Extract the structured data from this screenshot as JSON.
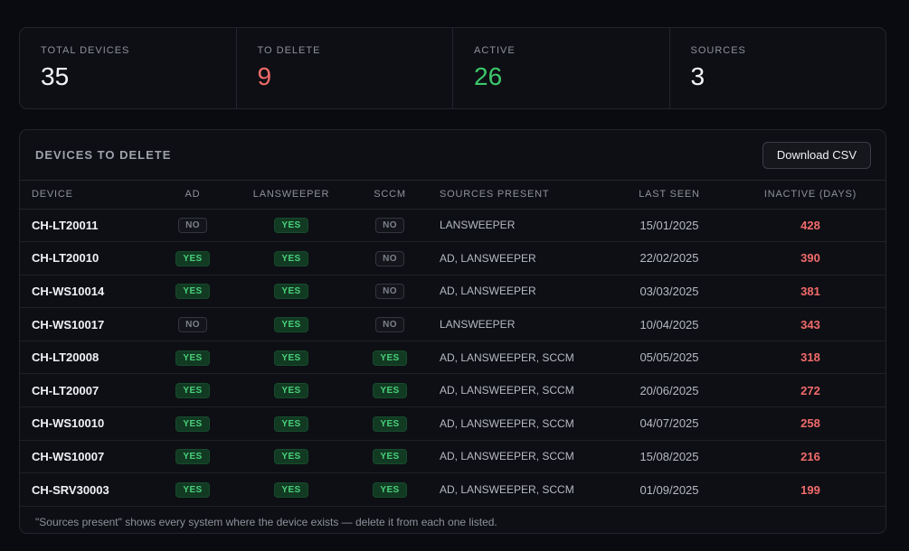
{
  "stats": [
    {
      "label": "TOTAL DEVICES",
      "value": "35",
      "color": "#f4f5f7"
    },
    {
      "label": "TO DELETE",
      "value": "9",
      "color": "#f26b6b"
    },
    {
      "label": "ACTIVE",
      "value": "26",
      "color": "#3cc76b"
    },
    {
      "label": "SOURCES",
      "value": "3",
      "color": "#f4f5f7"
    }
  ],
  "panel": {
    "title": "DEVICES TO DELETE",
    "download_label": "Download CSV",
    "columns": [
      "DEVICE",
      "AD",
      "LANSWEEPER",
      "SCCM",
      "SOURCES PRESENT",
      "LAST SEEN",
      "INACTIVE (DAYS)"
    ],
    "rows": [
      {
        "device": "CH-LT20011",
        "ad": "NO",
        "lansweeper": "YES",
        "sccm": "NO",
        "sources": "LANSWEEPER",
        "last_seen": "15/01/2025",
        "inactive": "428"
      },
      {
        "device": "CH-LT20010",
        "ad": "YES",
        "lansweeper": "YES",
        "sccm": "NO",
        "sources": "AD, LANSWEEPER",
        "last_seen": "22/02/2025",
        "inactive": "390"
      },
      {
        "device": "CH-WS10014",
        "ad": "YES",
        "lansweeper": "YES",
        "sccm": "NO",
        "sources": "AD, LANSWEEPER",
        "last_seen": "03/03/2025",
        "inactive": "381"
      },
      {
        "device": "CH-WS10017",
        "ad": "NO",
        "lansweeper": "YES",
        "sccm": "NO",
        "sources": "LANSWEEPER",
        "last_seen": "10/04/2025",
        "inactive": "343"
      },
      {
        "device": "CH-LT20008",
        "ad": "YES",
        "lansweeper": "YES",
        "sccm": "YES",
        "sources": "AD, LANSWEEPER, SCCM",
        "last_seen": "05/05/2025",
        "inactive": "318"
      },
      {
        "device": "CH-LT20007",
        "ad": "YES",
        "lansweeper": "YES",
        "sccm": "YES",
        "sources": "AD, LANSWEEPER, SCCM",
        "last_seen": "20/06/2025",
        "inactive": "272"
      },
      {
        "device": "CH-WS10010",
        "ad": "YES",
        "lansweeper": "YES",
        "sccm": "YES",
        "sources": "AD, LANSWEEPER, SCCM",
        "last_seen": "04/07/2025",
        "inactive": "258"
      },
      {
        "device": "CH-WS10007",
        "ad": "YES",
        "lansweeper": "YES",
        "sccm": "YES",
        "sources": "AD, LANSWEEPER, SCCM",
        "last_seen": "15/08/2025",
        "inactive": "216"
      },
      {
        "device": "CH-SRV30003",
        "ad": "YES",
        "lansweeper": "YES",
        "sccm": "YES",
        "sources": "AD, LANSWEEPER, SCCM",
        "last_seen": "01/09/2025",
        "inactive": "199"
      }
    ],
    "footnote": "\"Sources present\" shows every system where the device exists — delete it from each one listed."
  }
}
